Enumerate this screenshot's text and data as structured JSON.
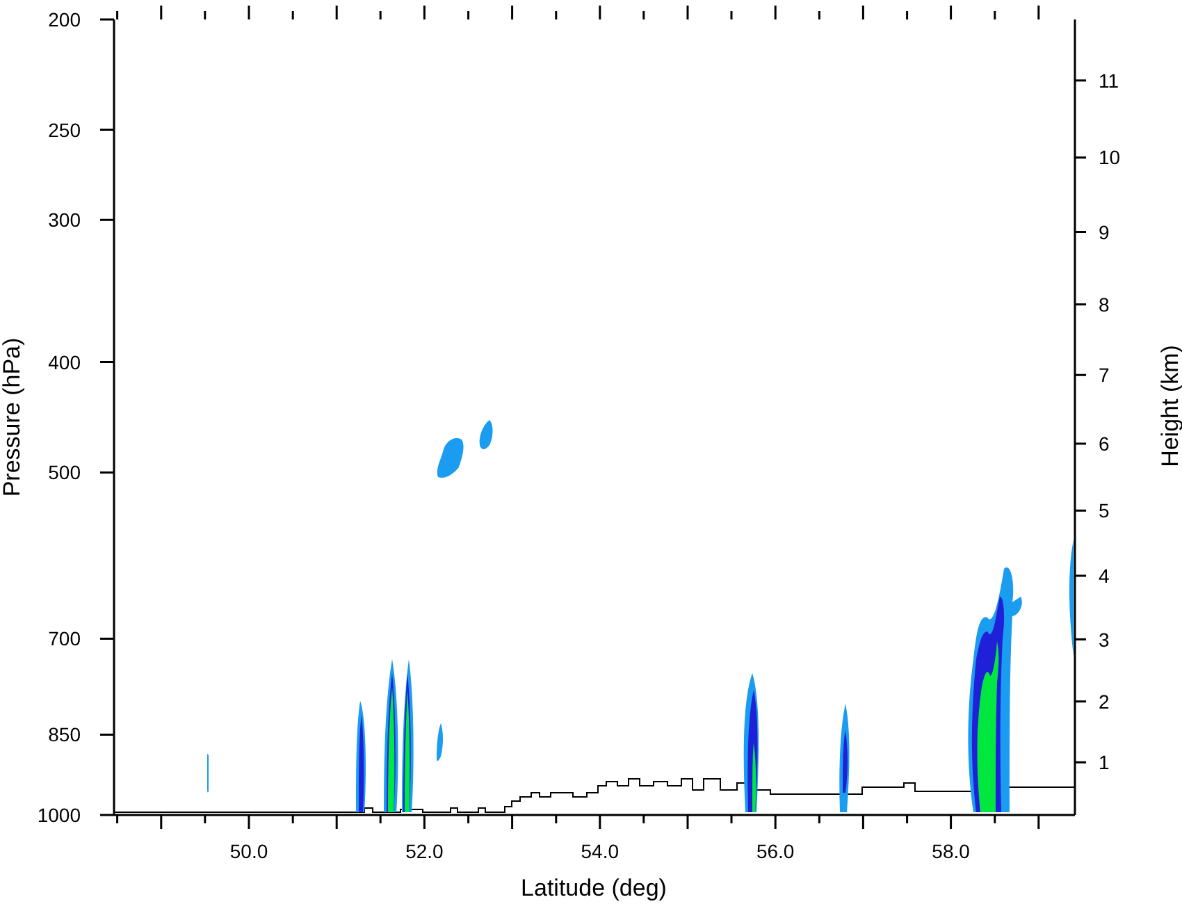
{
  "plot": {
    "xlabel": "Latitude (deg)",
    "ylabel_left": "Pressure (hPa)",
    "ylabel_right": "Height (km)",
    "x_ticks": [
      "50.0",
      "52.0",
      "54.0",
      "56.0",
      "58.0"
    ],
    "left_ticks": [
      "200",
      "250",
      "300",
      "400",
      "500",
      "700",
      "850",
      "1000"
    ],
    "right_ticks": [
      "11",
      "10",
      "9",
      "8",
      "7",
      "6",
      "5",
      "4",
      "3",
      "2",
      "1"
    ]
  }
}
